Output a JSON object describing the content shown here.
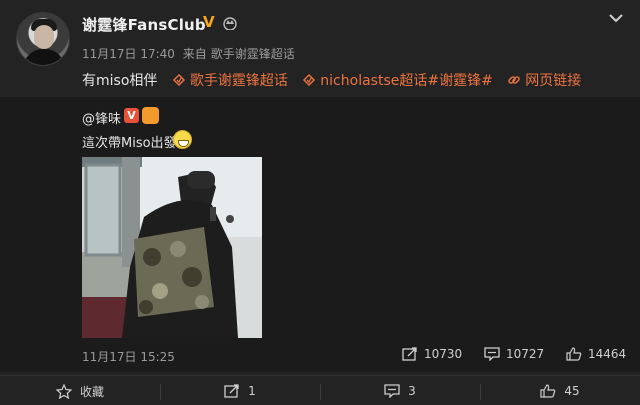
{
  "post": {
    "username": "谢霆锋FansClub",
    "verified_mark": "V",
    "timestamp": "11月17日 17:40",
    "source_prefix": "来自",
    "source": "歌手谢霆锋超话",
    "text": "有miso相伴",
    "links": [
      {
        "icon": "supertopic-icon",
        "label": "歌手谢霆锋超话"
      },
      {
        "icon": "supertopic-icon",
        "label": "nicholastse超话"
      },
      {
        "icon": "hashtag",
        "label": "#谢霆锋#"
      },
      {
        "icon": "link-icon",
        "label": "网页链接"
      }
    ]
  },
  "quote": {
    "author": "@锋味",
    "verified_mark": "V",
    "text": "這次帶Miso出發",
    "emoji": "grin-emoji",
    "time": "11月17日 15:25",
    "stats": {
      "reposts": "10730",
      "comments": "10727",
      "likes": "14464"
    }
  },
  "actions": {
    "favorite": "收藏",
    "repost": "1",
    "comment": "3",
    "like": "45"
  },
  "colors": {
    "background": "#232323",
    "quote_background": "#1b1b1b",
    "link": "#eb7340",
    "vip": "#f4a81e"
  }
}
